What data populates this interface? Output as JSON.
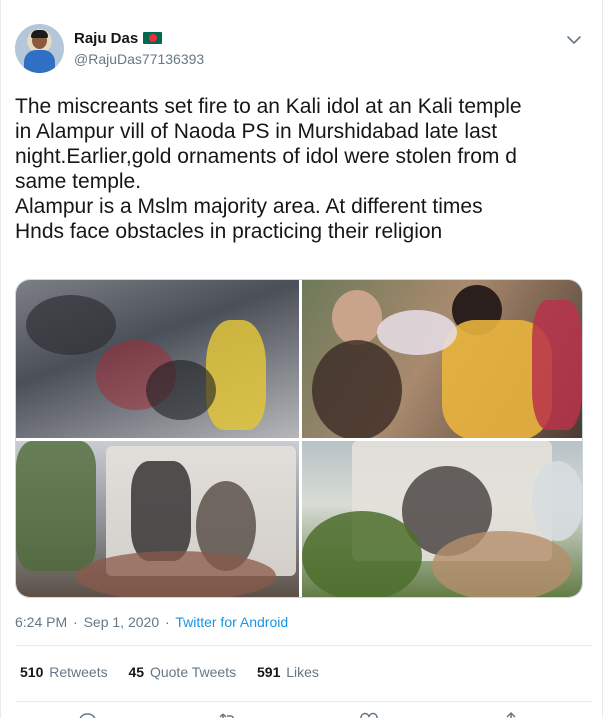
{
  "tweet": {
    "author": {
      "name": "Raju Das",
      "handle": "@RajuDas77136393"
    },
    "text_lines": [
      "The miscreants set fire to an Kali idol at an Kali temple",
      "in Alampur vill of Naoda PS in Murshidabad late last",
      "night.Earlier,gold ornaments of idol were stolen from d",
      "same temple.",
      "Alampur is a Mslm majority area. At different times",
      "Hnds face obstacles in practicing their religion"
    ],
    "media": {
      "photos": [
        "burnt-idol-photo",
        "crowd-at-idol-photo",
        "temple-exterior-photo",
        "temple-crowd-photo"
      ]
    },
    "time": "6:24 PM",
    "date": "Sep 1, 2020",
    "separator": "·",
    "source": "Twitter for Android",
    "stats": {
      "retweets_count": "510",
      "retweets_label": "Retweets",
      "quotes_count": "45",
      "quotes_label": "Quote Tweets",
      "likes_count": "591",
      "likes_label": "Likes"
    }
  },
  "icons": {
    "more": "chevron-down-icon",
    "reply": "reply-icon",
    "retweet": "retweet-icon",
    "like": "heart-icon",
    "share": "share-icon"
  },
  "colors": {
    "link": "#1b95e0",
    "secondary_text": "#657786",
    "primary_text": "#14171a",
    "border": "#e6ecf0"
  }
}
